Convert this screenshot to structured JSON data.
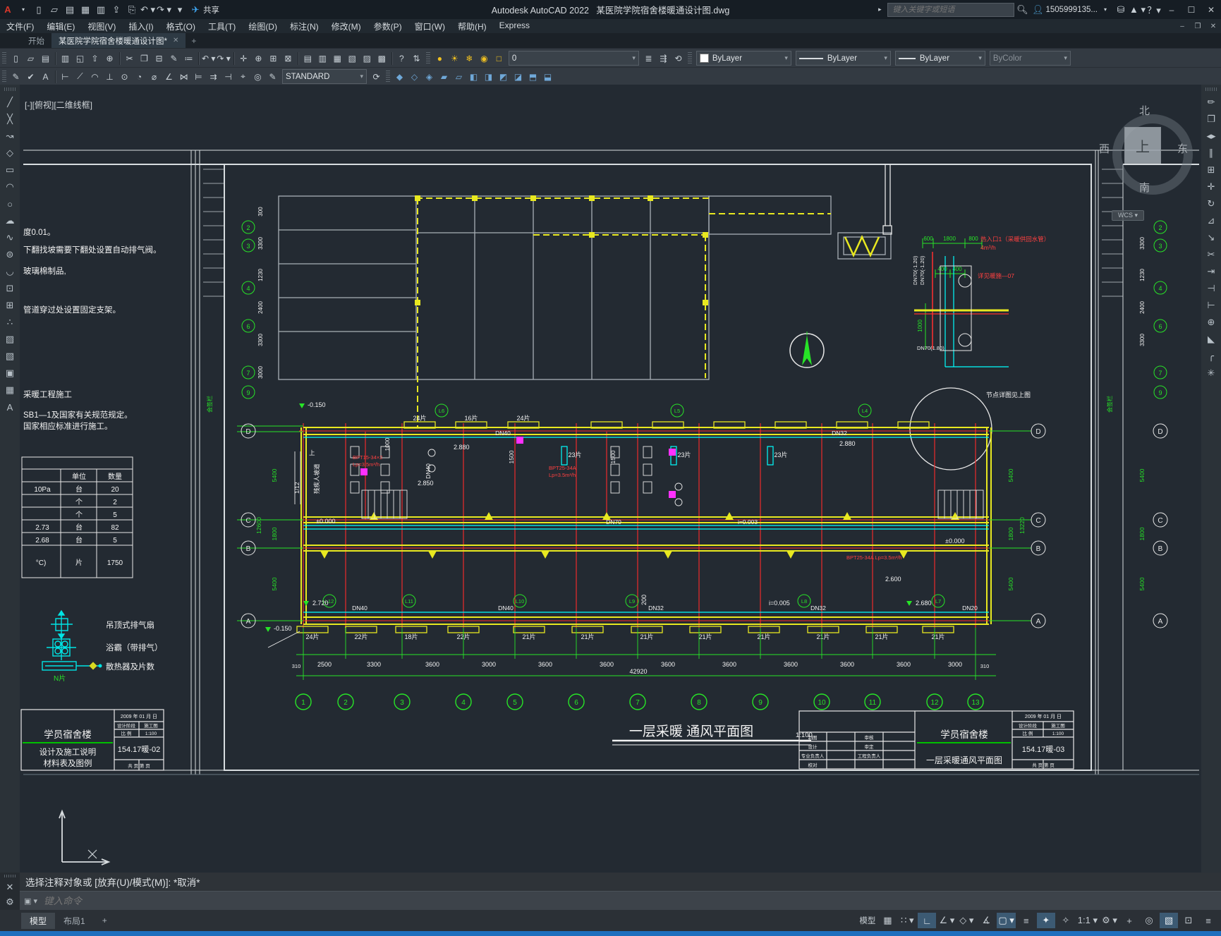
{
  "titlebar": {
    "app_title": "Autodesk AutoCAD 2022",
    "doc_title": "某医院学院宿舍楼暖通设计图.dwg",
    "search_placeholder": "键入关键字或短语",
    "account": "1505999135...",
    "share_label": "共享",
    "qat_icons": [
      {
        "name": "new-file-icon",
        "glyph": "▯"
      },
      {
        "name": "open-file-icon",
        "glyph": "▱"
      },
      {
        "name": "save-icon",
        "glyph": "▤"
      },
      {
        "name": "save-as-icon",
        "glyph": "▦"
      },
      {
        "name": "plot-icon",
        "glyph": "▥"
      },
      {
        "name": "publish-icon",
        "glyph": "⇪"
      },
      {
        "name": "print-icon",
        "glyph": "⎘"
      },
      {
        "name": "undo-icon",
        "glyph": "↶ ▾"
      },
      {
        "name": "redo-icon",
        "glyph": "↷ ▾"
      },
      {
        "name": "qat-more-icon",
        "glyph": "▾"
      }
    ]
  },
  "menus": [
    "文件(F)",
    "编辑(E)",
    "视图(V)",
    "插入(I)",
    "格式(O)",
    "工具(T)",
    "绘图(D)",
    "标注(N)",
    "修改(M)",
    "参数(P)",
    "窗口(W)",
    "帮助(H)",
    "Express"
  ],
  "file_tabs": {
    "start": "开始",
    "doc": "某医院学院宿舍楼暖通设计图*",
    "close": "✕",
    "plus": "+"
  },
  "toolbar1": {
    "group_file": [
      {
        "name": "new-icon",
        "glyph": "▯"
      },
      {
        "name": "open-icon",
        "glyph": "▱"
      },
      {
        "name": "save-icon",
        "glyph": "▤"
      }
    ],
    "group_print": [
      {
        "name": "plot-icon",
        "glyph": "▥"
      },
      {
        "name": "preview-icon",
        "glyph": "◱"
      },
      {
        "name": "publish-icon",
        "glyph": "⇧"
      },
      {
        "name": "export-icon",
        "glyph": "⊕"
      }
    ],
    "group_clipboard": [
      {
        "name": "cut-icon",
        "glyph": "✂"
      },
      {
        "name": "copy-icon",
        "glyph": "❐"
      },
      {
        "name": "paste-icon",
        "glyph": "⊟"
      },
      {
        "name": "match-properties-icon",
        "glyph": "✎"
      },
      {
        "name": "batch-plot-icon",
        "glyph": "≔"
      }
    ],
    "group_undo": [
      {
        "name": "undo-icon",
        "glyph": "↶ ▾"
      },
      {
        "name": "redo-icon",
        "glyph": "↷ ▾"
      }
    ],
    "group_nav": [
      {
        "name": "pan-icon",
        "glyph": "✛"
      },
      {
        "name": "zoom-realtime-icon",
        "glyph": "⊕"
      },
      {
        "name": "zoom-window-icon",
        "glyph": "⊞"
      },
      {
        "name": "zoom-previous-icon",
        "glyph": "⊠"
      }
    ],
    "group_palettes": [
      {
        "name": "layer-properties-icon",
        "glyph": "▤"
      },
      {
        "name": "layer-states-icon",
        "glyph": "▥"
      },
      {
        "name": "properties-icon",
        "glyph": "▦"
      },
      {
        "name": "sheetset-icon",
        "glyph": "▧"
      },
      {
        "name": "toolpalette-icon",
        "glyph": "▨"
      },
      {
        "name": "calculator-icon",
        "glyph": "▩"
      }
    ],
    "group_help": [
      {
        "name": "help-icon",
        "glyph": "?"
      },
      {
        "name": "sync-icon",
        "glyph": "⇅"
      }
    ],
    "layer_icons": [
      {
        "name": "layer-on-icon",
        "glyph": "●"
      },
      {
        "name": "layer-thaw-icon",
        "glyph": "☀"
      },
      {
        "name": "layer-viewport-icon",
        "glyph": "❄"
      },
      {
        "name": "layer-lock-icon",
        "glyph": "◉"
      },
      {
        "name": "layer-color-icon",
        "glyph": "□"
      }
    ],
    "layer_tools": [
      {
        "name": "make-current-icon",
        "glyph": "≣"
      },
      {
        "name": "match-layer-icon",
        "glyph": "⇶"
      },
      {
        "name": "previous-layer-icon",
        "glyph": "⟲"
      }
    ]
  },
  "layer": {
    "current": "0",
    "color": "ByLayer",
    "linetype": "ByLayer",
    "lineweight": "ByLayer",
    "plotstyle": "ByColor"
  },
  "toolbar2": {
    "group_text": [
      {
        "name": "text-edit-icon",
        "glyph": "✎"
      },
      {
        "name": "spell-check-icon",
        "glyph": "✔"
      },
      {
        "name": "text-style-icon",
        "glyph": "A"
      }
    ],
    "group_dims": [
      {
        "name": "dim-linear-icon",
        "glyph": "⊢"
      },
      {
        "name": "dim-aligned-icon",
        "glyph": "⟋"
      },
      {
        "name": "dim-arc-icon",
        "glyph": "◠"
      },
      {
        "name": "dim-ordinate-icon",
        "glyph": "⊥"
      },
      {
        "name": "dim-radius-icon",
        "glyph": "⊙"
      },
      {
        "name": "dim-jogged-icon",
        "glyph": "◔"
      },
      {
        "name": "dim-diameter-icon",
        "glyph": "⌀"
      },
      {
        "name": "dim-angular-icon",
        "glyph": "∠"
      },
      {
        "name": "dim-quick-icon",
        "glyph": "⋈"
      },
      {
        "name": "dim-baseline-icon",
        "glyph": "⊨"
      },
      {
        "name": "dim-continue-icon",
        "glyph": "⇉"
      },
      {
        "name": "dim-break-icon",
        "glyph": "⊣"
      },
      {
        "name": "dim-tolerance-icon",
        "glyph": "⌖"
      },
      {
        "name": "dim-center-icon",
        "glyph": "◎"
      },
      {
        "name": "dim-edit-icon",
        "glyph": "✎"
      }
    ],
    "style_name": "STANDARD",
    "group_after": [
      {
        "name": "dim-update-icon",
        "glyph": "⟳"
      }
    ],
    "group_solids": [
      {
        "name": "union-icon",
        "glyph": "◆"
      },
      {
        "name": "subtract-icon",
        "glyph": "◇"
      },
      {
        "name": "intersect-icon",
        "glyph": "◈"
      },
      {
        "name": "extrude-icon",
        "glyph": "▰"
      },
      {
        "name": "revolve-icon",
        "glyph": "▱"
      },
      {
        "name": "sweep-icon",
        "glyph": "◧"
      },
      {
        "name": "loft-icon",
        "glyph": "◨"
      },
      {
        "name": "slice-icon",
        "glyph": "◩"
      },
      {
        "name": "shell-icon",
        "glyph": "◪"
      },
      {
        "name": "3dmove-icon",
        "glyph": "⬒"
      },
      {
        "name": "3drotate-icon",
        "glyph": "⬓"
      }
    ]
  },
  "left_palette": [
    {
      "name": "line-icon",
      "glyph": "╱"
    },
    {
      "name": "xline-icon",
      "glyph": "╳"
    },
    {
      "name": "polyline-icon",
      "glyph": "↝"
    },
    {
      "name": "polygon-icon",
      "glyph": "◇"
    },
    {
      "name": "rectangle-icon",
      "glyph": "▭"
    },
    {
      "name": "arc-icon",
      "glyph": "◠"
    },
    {
      "name": "circle-icon",
      "glyph": "○"
    },
    {
      "name": "revcloud-icon",
      "glyph": "☁"
    },
    {
      "name": "spline-icon",
      "glyph": "∿"
    },
    {
      "name": "ellipse-icon",
      "glyph": "⊜"
    },
    {
      "name": "ellipse-arc-icon",
      "glyph": "◡"
    },
    {
      "name": "insert-block-icon",
      "glyph": "⊡"
    },
    {
      "name": "make-block-icon",
      "glyph": "⊞"
    },
    {
      "name": "point-icon",
      "glyph": "∴"
    },
    {
      "name": "hatch-icon",
      "glyph": "▨"
    },
    {
      "name": "gradient-icon",
      "glyph": "▧"
    },
    {
      "name": "region-icon",
      "glyph": "▣"
    },
    {
      "name": "table-icon",
      "glyph": "▦"
    },
    {
      "name": "mtext-icon",
      "glyph": "A"
    }
  ],
  "right_palette": [
    {
      "name": "erase-icon",
      "glyph": "✏"
    },
    {
      "name": "copy-icon",
      "glyph": "❐"
    },
    {
      "name": "mirror-icon",
      "glyph": "◂▸"
    },
    {
      "name": "offset-icon",
      "glyph": "∥"
    },
    {
      "name": "array-icon",
      "glyph": "⊞"
    },
    {
      "name": "move-icon",
      "glyph": "✛"
    },
    {
      "name": "rotate-icon",
      "glyph": "↻"
    },
    {
      "name": "scale-icon",
      "glyph": "⊿"
    },
    {
      "name": "stretch-icon",
      "glyph": "↘"
    },
    {
      "name": "trim-icon",
      "glyph": "✂"
    },
    {
      "name": "extend-icon",
      "glyph": "⇥"
    },
    {
      "name": "break-point-icon",
      "glyph": "⊣"
    },
    {
      "name": "break-icon",
      "glyph": "⊢"
    },
    {
      "name": "join-icon",
      "glyph": "⊕"
    },
    {
      "name": "chamfer-icon",
      "glyph": "◣"
    },
    {
      "name": "fillet-icon",
      "glyph": "╭"
    },
    {
      "name": "explode-icon",
      "glyph": "✳"
    }
  ],
  "viewport_label": "[-][俯视][二维线框]",
  "viewcube": {
    "n": "北",
    "s": "南",
    "w": "西",
    "e": "东",
    "top": "上",
    "wcs": "WCS ▾"
  },
  "huiqian": "会签栏",
  "notes": {
    "l1": "度0.01。",
    "l2": "下翻找坡需要下翻处设置自动排气阀。",
    "l3": "玻璃棉制品,",
    "l4": "管道穿过处设置固定支架。",
    "l5": "采暖工程施工",
    "l6": "SB1—1及国家有关规范规定。",
    "l7": "国家相应标准进行施工。"
  },
  "material_table": {
    "headers": {
      "unit": "单位",
      "qty": "数量"
    },
    "rows": [
      {
        "c1": "10Pa",
        "c2": "台",
        "c3": "20"
      },
      {
        "c1": "",
        "c2": "个",
        "c3": "2"
      },
      {
        "c1": "",
        "c2": "个",
        "c3": "5"
      },
      {
        "c1": "2.73",
        "c2": "台",
        "c3": "82"
      },
      {
        "c1": "2.68",
        "c2": "台",
        "c3": "5"
      },
      {
        "c1": "°C)",
        "c2": "片",
        "c3": "1750"
      }
    ]
  },
  "legend": {
    "item1": "吊顶式排气扇",
    "item2": "浴霸（带排气）",
    "item3": "散热器及片数",
    "note": "N片"
  },
  "tb_left": {
    "project": "学员宿舍楼",
    "line1": "设计及施工说明",
    "line2": "材料表及图例",
    "date": "2009 年 01 月 日",
    "stage_label": "设计阶段",
    "stage": "施工图",
    "scale_label": "比 例",
    "scale": "1:100",
    "number": "154.17暖-02",
    "pages": "共 页 第 页"
  },
  "tb_right": {
    "project": "学员宿舍楼",
    "sheet": "一层采暖通风平面图",
    "date": "2009 年 01 月 日",
    "stage_label": "设计阶段",
    "stage": "施工图",
    "scale_label": "比 例",
    "scale": "1:100",
    "number": "154.17暖-03",
    "pages": "共 页 第 页",
    "r1a": "制图",
    "r1b": "审核",
    "r2a": "设计",
    "r2b": "审定",
    "r3a": "专业负责人",
    "r3b": "工程负责人",
    "r4a": "校对"
  },
  "drawing_title": {
    "text": "一层采暖 通风平面图",
    "scale": "1:100"
  },
  "plan": {
    "axis_numbers": [
      "1",
      "2",
      "3",
      "4",
      "5",
      "6",
      "7",
      "8",
      "9",
      "10",
      "11",
      "12",
      "13"
    ],
    "bay_dims": [
      "2500",
      "3300",
      "3600",
      "3000",
      "3600",
      "3600",
      "3600",
      "3600",
      "3600",
      "3600",
      "3600",
      "3000"
    ],
    "total_dim": "42920",
    "end_dim_l": "310",
    "end_dim_r": "310",
    "row_letters": [
      "D",
      "C",
      "B",
      "A"
    ],
    "side_axis_numbers": [
      "2",
      "3",
      "4",
      "6",
      "7",
      "9"
    ],
    "side_dims_upper": [
      "300",
      "3300",
      "1230",
      "2400",
      "3300",
      "3000"
    ],
    "side_dims_rows": [
      "5400",
      "1800",
      "5400"
    ],
    "total_left": "12600",
    "total_right": "13220",
    "fins_top": [
      "24片",
      "16片",
      "24片"
    ],
    "fins_mid": [
      "23片",
      "23片",
      "23片"
    ],
    "fins_bottom": [
      "24片",
      "22片",
      "18片",
      "22片",
      "21片",
      "21片",
      "21片",
      "21片",
      "21片",
      "21片",
      "21片",
      "21片"
    ],
    "pipes_top": [
      "DN40",
      "DN32"
    ],
    "pipes_mid": [
      "DN70",
      "i=0.003"
    ],
    "pipes_bottom": [
      "DN40",
      "DN40",
      "DN32",
      "DN32",
      "DN20"
    ],
    "pipes_vert": "DN40",
    "risers_top": [
      "L6",
      "L5",
      "L4"
    ],
    "risers_bottom": [
      "L12",
      "L11",
      "L10",
      "L9",
      "L8",
      "L7"
    ],
    "interior_dims": [
      "1000",
      "1500",
      "1500"
    ],
    "elev": {
      "neg": "-0.150",
      "zero": "±0.000",
      "e2720": "2.720",
      "e2680": "2.680",
      "e2850": "2.850",
      "e2880": "2.880",
      "e2600": "2.600",
      "slope": "i=0.005",
      "v200": "200"
    },
    "red_specs": [
      "BPT15-34×2",
      "Lp=3.5m³/h",
      "BPT25-34A",
      "Lp=3.5m³/h",
      "BPT25-34A Lp=3.5m³/h"
    ],
    "ramp": {
      "up": "上",
      "label": "残疾人坡道",
      "slope": "1/12"
    }
  },
  "heat_entry": {
    "d600": "600",
    "d1800": "1800",
    "d800": "800",
    "d400a": "400",
    "d400b": "400",
    "d1000": "1000",
    "dn1": "DN70(-1.20)",
    "dn2": "DN70(-1.20)",
    "dn3": "DN70(1.80)",
    "note1": "热入口1（采暖供回水管）",
    "note2": "4m³/h",
    "note3": "详见暖施—07",
    "bubble_note": "节点详图见上图"
  },
  "command": {
    "history": "选择注释对象或  [放弃(U)/模式(M)]: *取消*",
    "placeholder": "键入命令"
  },
  "bottom_tabs": {
    "model": "模型",
    "layout1": "布局1",
    "plus": "+"
  },
  "status": {
    "model_label": "模型",
    "icons": [
      {
        "name": "grid-icon",
        "glyph": "▦"
      },
      {
        "name": "snap-icon",
        "glyph": "∷ ▾"
      },
      {
        "name": "ortho-icon",
        "glyph": "∟",
        "on": true
      },
      {
        "name": "polar-icon",
        "glyph": "∠ ▾"
      },
      {
        "name": "isodraft-icon",
        "glyph": "◇ ▾"
      },
      {
        "name": "otrack-icon",
        "glyph": "∡"
      },
      {
        "name": "osnap-icon",
        "glyph": "▢ ▾",
        "on": true
      },
      {
        "name": "lineweight-icon",
        "glyph": "≡"
      },
      {
        "name": "annotation-visibility-icon",
        "glyph": "✦",
        "on": true
      },
      {
        "name": "autoscale-icon",
        "glyph": "✧"
      },
      {
        "name": "annotation-scale",
        "glyph": "1:1 ▾"
      },
      {
        "name": "workspace-icon",
        "glyph": "⚙ ▾"
      },
      {
        "name": "crosshair-icon",
        "glyph": "+"
      },
      {
        "name": "isolate-icon",
        "glyph": "◎"
      },
      {
        "name": "graphics-performance-icon",
        "glyph": "▧",
        "on": true
      },
      {
        "name": "clean-screen-icon",
        "glyph": "⊡"
      },
      {
        "name": "customize-icon",
        "glyph": "≡"
      }
    ]
  }
}
